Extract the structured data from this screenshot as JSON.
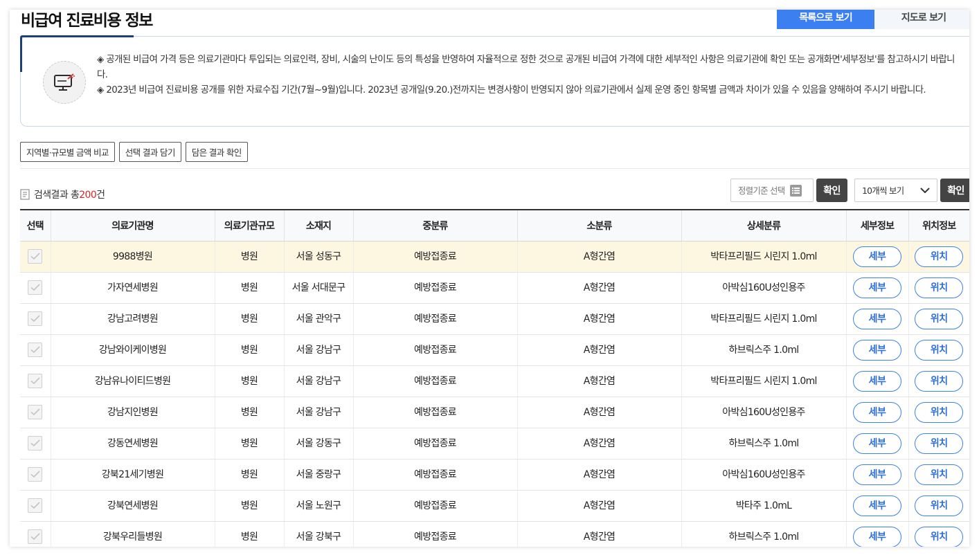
{
  "page_title": "비급여 진료비용 정보",
  "view_tabs": {
    "list": "목록으로 보기",
    "map": "지도로 보기"
  },
  "notice": {
    "line1": "◈ 공개된 비급여 가격 등은 의료기관마다 투입되는 의료인력, 장비, 시술의 난이도 등의 특성을 반영하여 자율적으로 정한 것으로 공개된 비급여 가격에 대한 세부적인 사항은 의료기관에 확인 또는 공개화면'세부정보'를 참고하시기 바랍니다.",
    "line2": "◈ 2023년 비급여 진료비용 공개를 위한 자료수집 기간(7월~9월)입니다. 2023년 공개일(9.20.)전까지는 변경사항이 반영되지 않아 의료기관에서 실제 운영 중인 항목별 금액과 차이가 있을 수 있음을 양해하여 주시기 바랍니다."
  },
  "actions": {
    "compare": "지역별·규모별 금액 비교",
    "save": "선택 결과 담기",
    "check": "담은 결과 확인"
  },
  "result": {
    "prefix": "검색결과 총",
    "count": "200",
    "suffix": "건"
  },
  "sort": {
    "label": "정렬기준 선택",
    "confirm": "확인"
  },
  "per_page": {
    "label": "10개씩 보기",
    "confirm": "확인"
  },
  "columns": [
    "선택",
    "의료기관명",
    "의료기관규모",
    "소재지",
    "중분류",
    "소분류",
    "상세분류",
    "세부정보",
    "위치정보"
  ],
  "detail_label": "세부",
  "location_label": "위치",
  "rows": [
    {
      "name": "9988병원",
      "size": "병원",
      "loc": "서울 성동구",
      "mid": "예방접종료",
      "small": "A형간염",
      "detail": "박타프리필드 시린지 1.0ml"
    },
    {
      "name": "가자연세병원",
      "size": "병원",
      "loc": "서울 서대문구",
      "mid": "예방접종료",
      "small": "A형간염",
      "detail": "아박심160U성인용주"
    },
    {
      "name": "강남고려병원",
      "size": "병원",
      "loc": "서울 관악구",
      "mid": "예방접종료",
      "small": "A형간염",
      "detail": "박타프리필드 시린지 1.0ml"
    },
    {
      "name": "강남와이케이병원",
      "size": "병원",
      "loc": "서울 강남구",
      "mid": "예방접종료",
      "small": "A형간염",
      "detail": "하브릭스주 1.0ml"
    },
    {
      "name": "강남유나이티드병원",
      "size": "병원",
      "loc": "서울 강남구",
      "mid": "예방접종료",
      "small": "A형간염",
      "detail": "박타프리필드 시린지 1.0ml"
    },
    {
      "name": "강남지인병원",
      "size": "병원",
      "loc": "서울 강남구",
      "mid": "예방접종료",
      "small": "A형간염",
      "detail": "아박심160U성인용주"
    },
    {
      "name": "강동연세병원",
      "size": "병원",
      "loc": "서울 강동구",
      "mid": "예방접종료",
      "small": "A형간염",
      "detail": "하브릭스주 1.0ml"
    },
    {
      "name": "강북21세기병원",
      "size": "병원",
      "loc": "서울 중랑구",
      "mid": "예방접종료",
      "small": "A형간염",
      "detail": "아박심160U성인용주"
    },
    {
      "name": "강북연세병원",
      "size": "병원",
      "loc": "서울 노원구",
      "mid": "예방접종료",
      "small": "A형간염",
      "detail": "박타주 1.0mL"
    },
    {
      "name": "강북우리들병원",
      "size": "병원",
      "loc": "서울 강북구",
      "mid": "예방접종료",
      "small": "A형간염",
      "detail": "하브릭스주 1.0ml"
    }
  ]
}
